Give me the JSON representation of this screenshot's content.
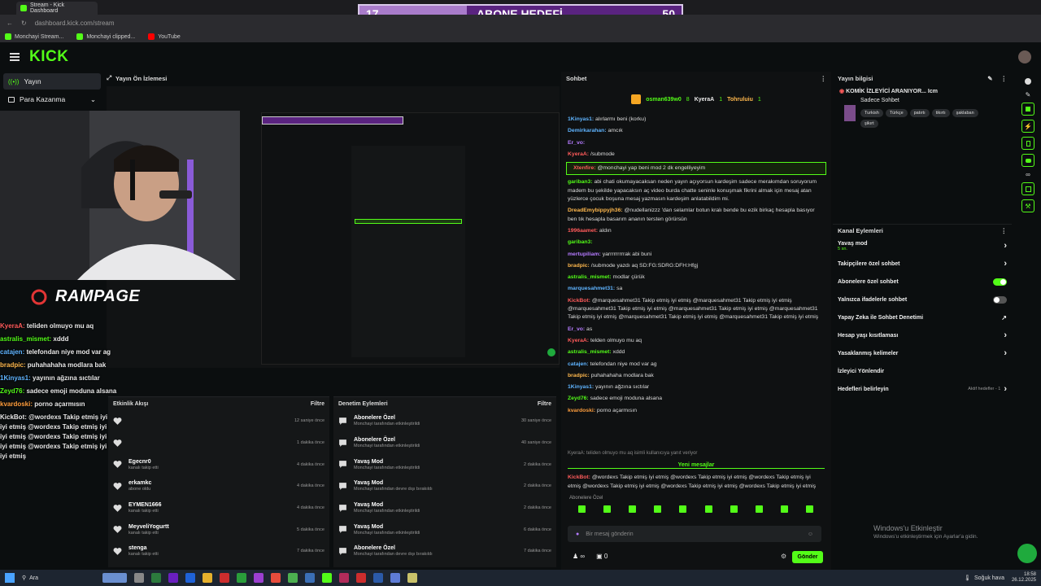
{
  "browser": {
    "tab_title": "Stream - Kick Dashboard",
    "url": "dashboard.kick.com/stream",
    "bookmarks": [
      "Monchayi Stream...",
      "Monchayi clipped...",
      "YouTube"
    ]
  },
  "goal_overlay": {
    "current": "17",
    "title": "ABONE HEDEFİ",
    "target": "50"
  },
  "header": {
    "logo": "KICK"
  },
  "nav": {
    "items": [
      {
        "label": "Yayın",
        "active": true
      },
      {
        "label": "Para Kazanma",
        "active": false
      }
    ]
  },
  "preview": {
    "title": "Yayın Ön İzlemesi",
    "brand": "RAMPAGE",
    "overlay_chat": [
      {
        "user": "",
        "text": "teliden olmuyo mu aq",
        "color": "#ff5b5b"
      },
      {
        "user": "astralis_mismet:",
        "text": "xddd",
        "color": "#53fc18"
      },
      {
        "user": "catajen:",
        "text": "telefondan niye mod var ag",
        "color": "#5fb4ff"
      },
      {
        "user": "bradpic:",
        "text": "puhahahaha modlara bak",
        "color": "#ffb84d"
      },
      {
        "user": "1Kinyas1:",
        "text": "yayının ağzına sıctılar",
        "color": "#5fb4ff"
      },
      {
        "user": "Zeyd76:",
        "text": "sadece emoji moduna alsana",
        "color": "#53fc18"
      },
      {
        "user": "kvardoski:",
        "text": "porno açarmısın",
        "color": "#ff9e3d"
      }
    ],
    "overlay_kickbot": "KickBot: @wordexs Takip etmiş iyi etmiş @wordexs Takip etmiş iyi etmiş @wordexs Takip etmiş iyi etmiş @wordexs Takip etmiş iyi etmiş @wordexs Takip etmiş iyi etmiş @wordexs Takip etmiş iyi etmiş @wordexs Takip etmiş iyi etmiş @wordexs Takip etmiş iyi etmiş"
  },
  "activity": {
    "title": "Etkinlik Akışı",
    "filter": "Filtre",
    "rows": [
      {
        "name": "",
        "sub": "",
        "time": "12 saniye önce"
      },
      {
        "name": "",
        "sub": "",
        "time": "1 dakika önce"
      },
      {
        "name": "Egecnr0",
        "sub": "kanalı takip etti",
        "time": "4 dakika önce"
      },
      {
        "name": "erkamkc",
        "sub": "abone oldu",
        "time": "4 dakika önce"
      },
      {
        "name": "EYMEN1666",
        "sub": "kanalı takip etti",
        "time": "4 dakika önce"
      },
      {
        "name": "MeyveliYogurtt",
        "sub": "kanalı takip etti",
        "time": "5 dakika önce"
      },
      {
        "name": "stenga",
        "sub": "kanalı takip etti",
        "time": "7 dakika önce"
      }
    ]
  },
  "moderation": {
    "title": "Denetim Eylemleri",
    "filter": "Filtre",
    "rows": [
      {
        "name": "Abonelere Özel",
        "sub": "Monchayi tarafından etkinleştirildi",
        "time": "30 saniye önce"
      },
      {
        "name": "Abonelere Özel",
        "sub": "Monchayi tarafından etkinleştirildi",
        "time": "40 saniye önce"
      },
      {
        "name": "Yavaş Mod",
        "sub": "Monchayi tarafından etkinleştirildi",
        "time": "2 dakika önce"
      },
      {
        "name": "Yavaş Mod",
        "sub": "Monchayi tarafından devre dışı bırakıldı",
        "time": "2 dakika önce"
      },
      {
        "name": "Yavaş Mod",
        "sub": "Monchayi tarafından etkinleştirildi",
        "time": "2 dakika önce"
      },
      {
        "name": "Yavaş Mod",
        "sub": "Monchayi tarafından etkinleştirildi",
        "time": "6 dakika önce"
      },
      {
        "name": "Abonelere Özel",
        "sub": "Monchayi tarafından devre dışı bırakıldı",
        "time": "7 dakika önce"
      }
    ]
  },
  "chat": {
    "title": "Sohbet",
    "pinned": {
      "user1": "osman639w0",
      "user1_count": "8",
      "user2": "KyeraA",
      "user2_count": "1",
      "user3": "Tohruluiu",
      "user3_count": "1"
    },
    "messages": [
      {
        "user": "1Kinyas1:",
        "text": "alırlarmı beni (korku)",
        "color": "#5fb4ff"
      },
      {
        "user": "Demirkarahan:",
        "text": "amcık",
        "color": "#5fb4ff"
      },
      {
        "user": "Er_vo:",
        "text": "",
        "color": "#b57bff"
      },
      {
        "user": "KyeraA:",
        "text": "/submode",
        "color": "#ff5b5b"
      },
      {
        "user": "Xtenfire:",
        "text": "@monchayi yap beni mod 2 dk engelliyeyim",
        "color": "#ff5b5b",
        "highlight": true
      },
      {
        "user": "gariban3:",
        "text": "abi chati okumayacaksan neden yayın açıyorsun kardeşim sadece merakımdan soruyorum madem bu şekilde yapacaksın aç video burda chatte seninle konuşmak fikrini almak için mesaj atan yüzlerce çocuk boşuna mesaj yazmasın kardeşim anlatabildim mi.",
        "color": "#53fc18"
      },
      {
        "user": "DreadEmybippyjh36:",
        "text": "@nudellanizzz 'dan selamlar botun kralı bende bu ezik birkaç hesapla basıyor ben tık hesapla basarım ananın tersten görürsün",
        "color": "#ffb84d"
      },
      {
        "user": "1996aamet:",
        "text": "aldın",
        "color": "#ff5b5b"
      },
      {
        "user": "gariban3:",
        "text": "",
        "color": "#53fc18"
      },
      {
        "user": "mertupiliam:",
        "text": "yarrrrrrrrrak abi buni",
        "color": "#b57bff"
      },
      {
        "user": "bradpic:",
        "text": "/submode yazdı aq SD:FG:SDRG:DFH:Hfgj",
        "color": "#ffb84d"
      },
      {
        "user": "astralis_mismet:",
        "text": "modlar çürük",
        "color": "#53fc18"
      },
      {
        "user": "marquesahmet31:",
        "text": "sa",
        "color": "#5fb4ff"
      },
      {
        "user": "KickBot:",
        "text": "@marquesahmet31 Takip etmiş iyi etmiş @marquesahmet31 Takip etmiş iyi etmiş @marquesahmet31 Takip etmiş iyi etmiş @marquesahmet31 Takip etmiş iyi etmiş @marquesahmet31 Takip etmiş iyi etmiş @marquesahmet31 Takip etmiş iyi etmiş @marquesahmet31 Takip etmiş iyi etmiş",
        "color": "#ff5b5b"
      },
      {
        "user": "Er_vo:",
        "text": "as",
        "color": "#b57bff"
      },
      {
        "user": "KyeraA:",
        "text": "telden olmuyo mu aq",
        "color": "#ff5b5b"
      },
      {
        "user": "astralis_mismet:",
        "text": "xddd",
        "color": "#53fc18"
      },
      {
        "user": "catajen:",
        "text": "telefondan niye mod var ag",
        "color": "#5fb4ff"
      },
      {
        "user": "bradpic:",
        "text": "puhahahaha modlara bak",
        "color": "#ffb84d"
      },
      {
        "user": "1Kinyas1:",
        "text": "yayının ağzına sıctılar",
        "color": "#5fb4ff"
      },
      {
        "user": "Zeyd76:",
        "text": "sadece emoji moduna alsana",
        "color": "#53fc18"
      },
      {
        "user": "kvardoski:",
        "text": "porno açarmısın",
        "color": "#ff9e3d"
      }
    ],
    "reply_hint": "KyeraA: teliden olmuyo mu aq isimli kullanıcıya yanıt veriyor",
    "new_messages": "Yeni mesajlar",
    "last_message": {
      "user": "KickBot:",
      "text": "@wordexs Takip etmiş iyi etmiş @wordexs Takip etmiş iyi etmiş @wordexs Takip etmiş iyi etmiş @wordexs Takip etmiş iyi etmiş @wordexs Takip etmiş iyi etmiş @wordexs Takip etmiş iyi etmiş",
      "color": "#ff5b5b"
    },
    "mode_label": "Abonelere Özel",
    "input_placeholder": "Bir mesaj gönderin",
    "viewer_count": "∞",
    "gift_count": "0",
    "send_label": "Gönder"
  },
  "stream_info": {
    "title": "Yayın bilgisi",
    "stream_title": "KOMİK İZLEYİCİ ARANIYOR... Icm",
    "category": "Sadece Sohbet",
    "tags": [
      "Turkish",
      "Türkçe",
      "patırtı",
      "tikırtı",
      "şaklaban",
      "şikırt"
    ]
  },
  "channel_actions": {
    "title": "Kanal Eylemleri",
    "items": [
      {
        "label": "Yavaş mod",
        "sub": "5 sn.",
        "control": "chevron"
      },
      {
        "label": "Takipçilere özel sohbet",
        "sub": "",
        "control": "chevron"
      },
      {
        "label": "Abonelere özel sohbet",
        "sub": "",
        "control": "toggle-on"
      },
      {
        "label": "Yalnızca ifadelerle sohbet",
        "sub": "",
        "control": "toggle-off"
      },
      {
        "label": "Yapay Zeka ile Sohbet Denetimi",
        "sub": "",
        "control": "external"
      },
      {
        "label": "Hesap yaşı kısıtlaması",
        "sub": "",
        "control": "chevron"
      },
      {
        "label": "Yasaklanmış kelimeler",
        "sub": "",
        "control": "chevron"
      },
      {
        "label": "İzleyici Yönlendir",
        "sub": "",
        "control": "none"
      },
      {
        "label": "Hedefleri belirleyin",
        "sub": "Aktif hedefler - 1",
        "control": "chevron"
      }
    ]
  },
  "watermark": {
    "line1": "Windows'u Etkinleştir",
    "line2": "Windows'u etkinleştirmek için Ayarlar'a gidin."
  },
  "taskbar": {
    "search": "Ara",
    "weather": "Soğuk hava",
    "time": "18:58",
    "date": "26.12.2025"
  },
  "colors": {
    "accent": "#53fc18",
    "goal_bg": "#5a2380",
    "goal_fill": "#a97ccb"
  }
}
